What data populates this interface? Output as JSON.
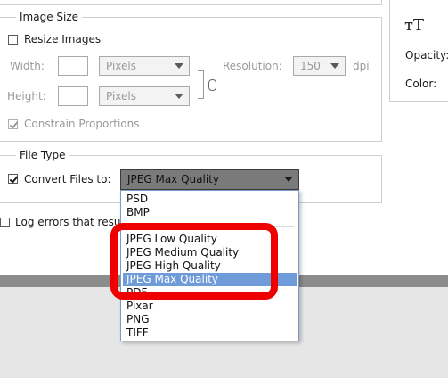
{
  "image_size": {
    "title": "Image Size",
    "resize_label": "Resize Images",
    "width_label": "Width:",
    "height_label": "Height:",
    "unit_value": "Pixels",
    "resolution_label": "Resolution:",
    "resolution_value": "150",
    "resolution_unit": "dpi",
    "constrain_label": "Constrain Proportions"
  },
  "file_type": {
    "title": "File Type",
    "convert_label": "Convert Files to:",
    "selected_value": "JPEG Max Quality"
  },
  "log_errors_label": "Log errors that result",
  "right_panel": {
    "type_icon": "type-tool-icon",
    "opacity_label": "Opacity:",
    "color_label": "Color:"
  },
  "dropdown_items": [
    "PSD",
    "BMP",
    "JPEG Low Quality",
    "JPEG Medium Quality",
    "JPEG High Quality",
    "JPEG Max Quality",
    "PDF",
    "Pixar",
    "PNG",
    "TIFF"
  ],
  "colors": {
    "highlight": "#ee0000",
    "selection": "#6f9bd9"
  }
}
